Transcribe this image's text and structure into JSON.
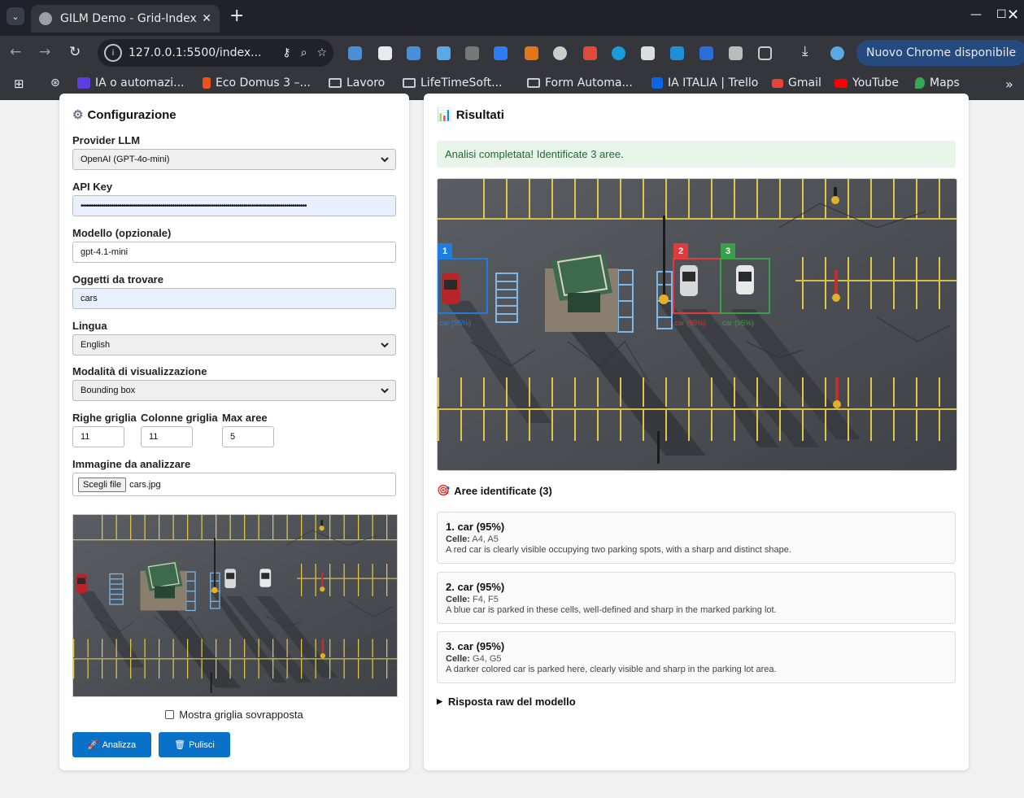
{
  "browser": {
    "tab_title": "GILM Demo - Grid-Indexe",
    "url": "127.0.0.1:5500/index...",
    "update_label": "Nuovo Chrome disponibile",
    "bookmarks": [
      {
        "label": "IA o automazi...",
        "color": "#5b3de0"
      },
      {
        "label": "Eco Domus 3 –...",
        "color": "#f24e1e"
      },
      {
        "label": "Lavoro",
        "color": "folder"
      },
      {
        "label": "LifeTimeSoft...",
        "color": "folder"
      },
      {
        "label": "Form Automa...",
        "color": "folder"
      },
      {
        "label": "IA ITALIA | Trello",
        "color": "#0c66e4"
      },
      {
        "label": "Gmail",
        "color": "#ea4335"
      },
      {
        "label": "YouTube",
        "color": "#ff0000"
      },
      {
        "label": "Maps",
        "color": "#34a853"
      }
    ]
  },
  "config": {
    "title": "Configurazione",
    "provider_label": "Provider LLM",
    "provider_value": "OpenAI (GPT-4o-mini)",
    "apikey_label": "API Key",
    "apikey_value": "•••••••••••••••••••••••••••••••••••••••••••••••••••••••••••••••••••••••••••••••••••••••••••••••••••••••••••••••",
    "model_label": "Modello (opzionale)",
    "model_value": "gpt-4.1-mini",
    "objects_label": "Oggetti da trovare",
    "objects_value": "cars",
    "language_label": "Lingua",
    "language_value": "English",
    "viz_label": "Modalità di visualizzazione",
    "viz_value": "Bounding box",
    "rows_label": "Righe griglia",
    "rows_value": "11",
    "cols_label": "Colonne griglia",
    "cols_value": "11",
    "max_label": "Max aree",
    "max_value": "5",
    "image_label": "Immagine da analizzare",
    "file_button": "Scegli file",
    "file_name": "cars.jpg",
    "grid_checkbox_label": "Mostra griglia sovrapposta",
    "analyze_label": "Analizza",
    "clear_label": "Pulisci"
  },
  "results": {
    "title": "Risultati",
    "success_message": "Analisi completata! Identificate 3 aree.",
    "areas_title": "Aree identificate (3)",
    "box_labels": [
      "car (95%)",
      "car (95%)",
      "car (95%)"
    ],
    "areas": [
      {
        "number": "1",
        "color": "#1e7de0",
        "title": "1. car (95%)",
        "cells_label": "Celle:",
        "cells": "A4, A5",
        "description": "A red car is clearly visible occupying two parking spots, with a sharp and distinct shape."
      },
      {
        "number": "2",
        "color": "#e03a3a",
        "title": "2. car (95%)",
        "cells_label": "Celle:",
        "cells": "F4, F5",
        "description": "A blue car is parked in these cells, well-defined and sharp in the marked parking lot."
      },
      {
        "number": "3",
        "color": "#3a9e4a",
        "title": "3. car (95%)",
        "cells_label": "Celle:",
        "cells": "G4, G5",
        "description": "A darker colored car is parked here, clearly visible and sharp in the parking lot area."
      }
    ],
    "raw_label": "Risposta raw del modello"
  }
}
